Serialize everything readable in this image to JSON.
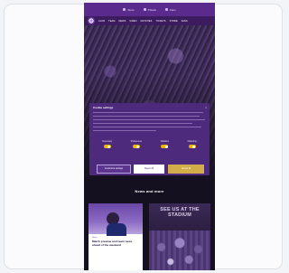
{
  "topbar": {
    "items": [
      {
        "label": "Store",
        "icon": "bag-icon"
      },
      {
        "label": "Tickets",
        "icon": "ticket-icon"
      },
      {
        "label": "Fans",
        "icon": "user-icon"
      }
    ]
  },
  "nav": {
    "items": [
      "CLUB",
      "TEAM",
      "NEWS",
      "VIDEO",
      "MATCHES",
      "TICKETS",
      "STORE",
      "FANS"
    ]
  },
  "consent": {
    "title": "Cookie settings",
    "close": "×",
    "toggles": [
      {
        "label": "Necessary",
        "on": true
      },
      {
        "label": "Preferences",
        "on": true
      },
      {
        "label": "Statistics",
        "on": true
      },
      {
        "label": "Marketing",
        "on": true
      }
    ],
    "customize_label": "Customize settings",
    "reject_label": "Reject all",
    "accept_label": "Accept all"
  },
  "news": {
    "section_title": "News and more",
    "card": {
      "tag": "News",
      "headline": "Match preview and team news ahead of the weekend",
      "date": ""
    },
    "promo_text": "SEE US AT THE STADIUM"
  },
  "colors": {
    "brand_purple": "#5a2a8c",
    "accent_gold": "#d3ad49",
    "toggle_on": "#f0b400"
  }
}
